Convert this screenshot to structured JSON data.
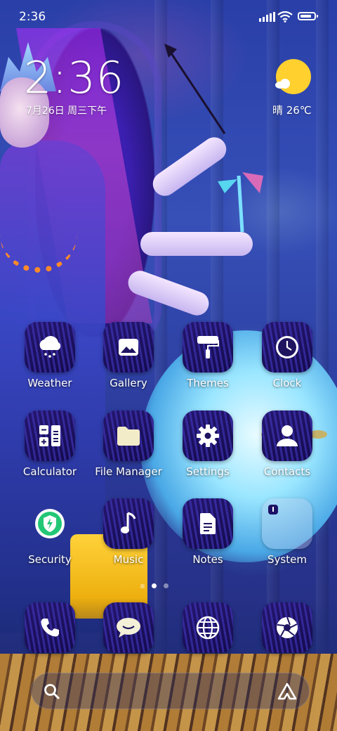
{
  "status_bar": {
    "time": "2:36",
    "signal_icon": "signal-bars-icon",
    "wifi_icon": "wifi-icon",
    "battery_icon": "battery-icon",
    "battery_level": 0.85
  },
  "clock_widget": {
    "time": "2:36",
    "date": "7月26日 周三下午"
  },
  "weather_widget": {
    "icon": "sunny-cloud-icon",
    "text": "晴 26℃",
    "sun_color": "#ffd02e"
  },
  "apps": [
    {
      "label": "Weather",
      "icon": "weather-cloud-icon"
    },
    {
      "label": "Gallery",
      "icon": "gallery-icon"
    },
    {
      "label": "Themes",
      "icon": "paint-roller-icon"
    },
    {
      "label": "Clock",
      "icon": "clock-icon"
    },
    {
      "label": "Calculator",
      "icon": "calculator-icon"
    },
    {
      "label": "File Manager",
      "icon": "folder-icon"
    },
    {
      "label": "Settings",
      "icon": "gear-icon"
    },
    {
      "label": "Contacts",
      "icon": "person-icon"
    },
    {
      "label": "Security",
      "icon": "security-shield-icon"
    },
    {
      "label": "Music",
      "icon": "music-note-icon"
    },
    {
      "label": "Notes",
      "icon": "note-icon"
    },
    {
      "label": "System",
      "icon": "folder-system-icon"
    }
  ],
  "page_indicator": {
    "pages": 3,
    "active": 2
  },
  "dock": [
    {
      "icon": "phone-icon"
    },
    {
      "icon": "messages-icon"
    },
    {
      "icon": "browser-globe-icon"
    },
    {
      "icon": "camera-aperture-icon"
    }
  ],
  "search_bar": {
    "left_icon": "search-icon",
    "right_icon": "assistant-icon"
  }
}
